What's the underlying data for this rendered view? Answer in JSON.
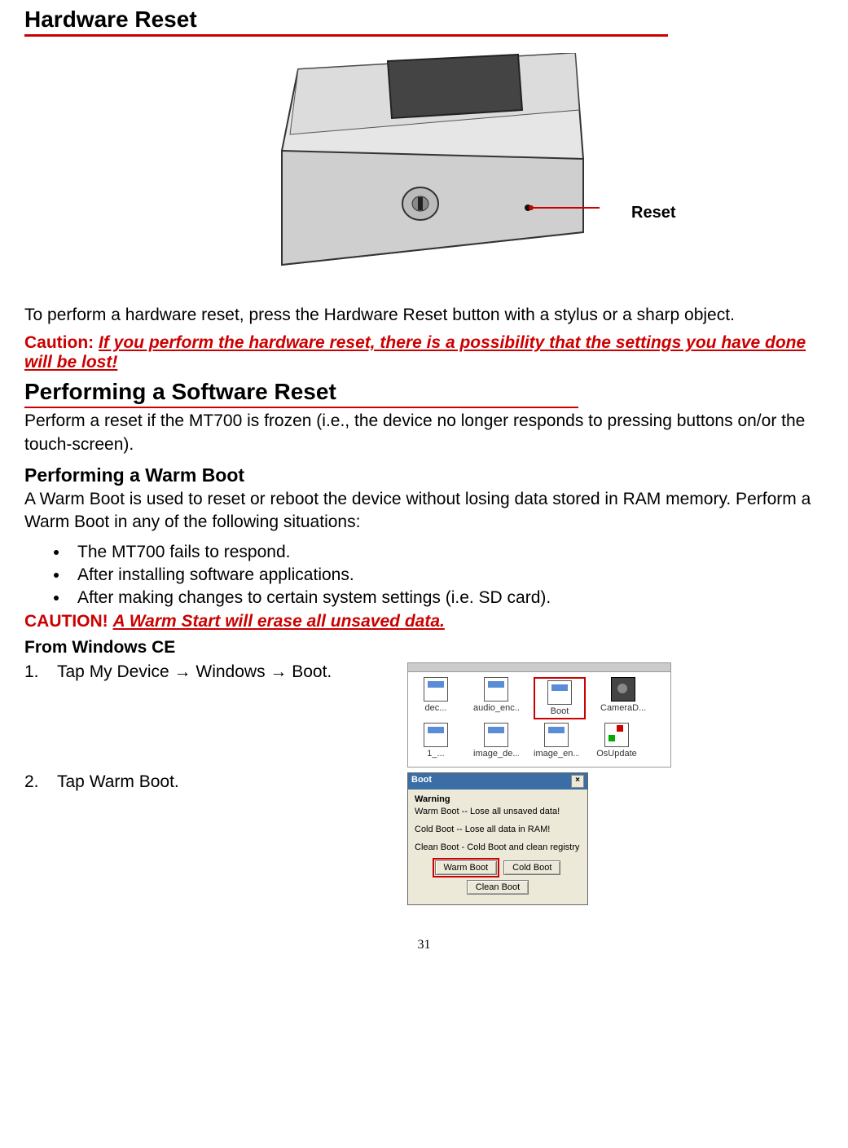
{
  "heading1": "Hardware Reset",
  "diagram": {
    "label": "Reset"
  },
  "para1": "To perform a hardware reset, press the Hardware Reset button with a stylus or a sharp object.",
  "caution1": {
    "prefix": "Caution: ",
    "msg": "If you perform the hardware reset, there is a possibility that the settings you have done will be lost!"
  },
  "heading2": "Performing a Software Reset",
  "para2": "Perform a reset if the MT700 is frozen (i.e., the device no longer responds to pressing buttons on/or the touch-screen).",
  "subheading1": "Performing a Warm Boot",
  "para3": "A Warm Boot is used to reset or reboot the device without losing data stored in RAM memory. Perform a Warm Boot in any of the following situations:",
  "bullets": [
    "The MT700 fails to respond.",
    "After installing software applications.",
    "After making changes to certain system settings (i.e. SD card)."
  ],
  "caution2": {
    "prefix": "CAUTION! ",
    "msg": "A Warm Start will erase all unsaved data."
  },
  "fromce": "From Windows CE",
  "step1": {
    "num": "1.",
    "text": "Tap My Device  →  Windows  →  Boot."
  },
  "step2": {
    "num": "2.",
    "text": "Tap Warm Boot."
  },
  "explorer": {
    "row1": [
      {
        "label": "dec...",
        "type": "file"
      },
      {
        "label": "audio_enc...",
        "type": "file"
      },
      {
        "label": "Boot",
        "type": "file",
        "highlight": true
      },
      {
        "label": "CameraD...",
        "type": "cam"
      }
    ],
    "row2": [
      {
        "label": "1_...",
        "type": "file"
      },
      {
        "label": "image_de...",
        "type": "file"
      },
      {
        "label": "image_en...",
        "type": "file"
      },
      {
        "label": "OsUpdate",
        "type": "upd"
      }
    ]
  },
  "dialog": {
    "title": "Boot",
    "close": "×",
    "warn_title": "Warning",
    "line1": "Warm Boot -- Lose all unsaved data!",
    "line2": "Cold Boot -- Lose all data in RAM!",
    "line3": "Clean Boot - Cold Boot and clean registry",
    "buttons": {
      "warm": "Warm Boot",
      "cold": "Cold Boot",
      "clean": "Clean Boot"
    }
  },
  "page_number": "31"
}
